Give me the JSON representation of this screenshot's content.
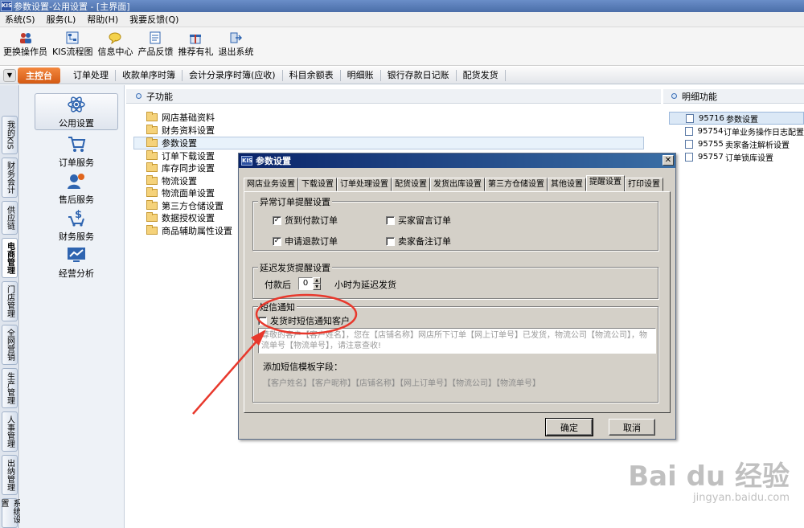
{
  "window": {
    "title": "参数设置-公用设置 - [主界面]",
    "logo": "KIS"
  },
  "menu": [
    "系统(S)",
    "服务(L)",
    "帮助(H)",
    "我要反馈(Q)"
  ],
  "toolbar": [
    {
      "label": "更换操作员",
      "icon": "users-icon"
    },
    {
      "label": "KIS流程图",
      "icon": "flowchart-icon"
    },
    {
      "label": "信息中心",
      "icon": "chat-icon"
    },
    {
      "label": "产品反馈",
      "icon": "feedback-icon"
    },
    {
      "label": "推荐有礼",
      "icon": "gift-icon"
    },
    {
      "label": "退出系统",
      "icon": "exit-icon"
    }
  ],
  "tabs": {
    "home": "主控台",
    "items": [
      "订单处理",
      "收款单序时簿",
      "会计分录序时簿(应收)",
      "科目余额表",
      "明细账",
      "银行存款日记账",
      "配货发货"
    ]
  },
  "vnav": [
    "我的KIS",
    "财务会计",
    "供应链",
    "电商管理",
    "门店管理",
    "全网营销",
    "生产管理",
    "人事管理",
    "出纳管理",
    "系统设置"
  ],
  "categories": [
    "公用设置",
    "订单服务",
    "售后服务",
    "财务服务",
    "经营分析"
  ],
  "sub": {
    "header": "子功能",
    "items": [
      "网店基础资料",
      "财务资料设置",
      "参数设置",
      "订单下载设置",
      "库存同步设置",
      "物流设置",
      "物流面单设置",
      "第三方仓储设置",
      "数据授权设置",
      "商品辅助属性设置"
    ]
  },
  "detail": {
    "header": "明细功能",
    "items": [
      {
        "code": "95716",
        "label": "参数设置"
      },
      {
        "code": "95754",
        "label": "订单业务操作日志配置"
      },
      {
        "code": "95755",
        "label": "卖家备注解析设置"
      },
      {
        "code": "95757",
        "label": "订单锁库设置"
      }
    ]
  },
  "dialog": {
    "title": "参数设置",
    "tabs": [
      "网店业务设置",
      "下载设置",
      "订单处理设置",
      "配货设置",
      "发货出库设置",
      "第三方仓储设置",
      "其他设置",
      "提醒设置",
      "打印设置"
    ],
    "active_tab": "提醒设置",
    "group1": {
      "title": "异常订单提醒设置",
      "checks": [
        {
          "label": "货到付款订单",
          "checked": true
        },
        {
          "label": "买家留言订单",
          "checked": false
        },
        {
          "label": "申请退款订单",
          "checked": true
        },
        {
          "label": "卖家备注订单",
          "checked": false
        }
      ]
    },
    "group2": {
      "title": "延迟发货提醒设置",
      "prefix": "付款后",
      "value": "0",
      "suffix": "小时为延迟发货"
    },
    "group3": {
      "title": "短信通知",
      "check_label": "发货时短信通知客户",
      "checked": false,
      "template": "尊敬的客户【客户姓名】，您在【店铺名称】网店所下订单【网上订单号】已发货，物流公司【物流公司】，物流单号【物流单号】，请注意查收!",
      "fields_label": "添加短信模板字段：",
      "fields": "【客户姓名】【客户昵称】【店铺名称】【网上订单号】【物流公司】【物流单号】"
    },
    "ok": "确定",
    "cancel": "取消"
  },
  "watermark": {
    "brand": "Bai du 经验",
    "url": "jingyan.baidu.com"
  },
  "colors": {
    "accent_orange": "#e0651c",
    "annotation_red": "#e8382c",
    "title_blue": "#0a246a"
  }
}
